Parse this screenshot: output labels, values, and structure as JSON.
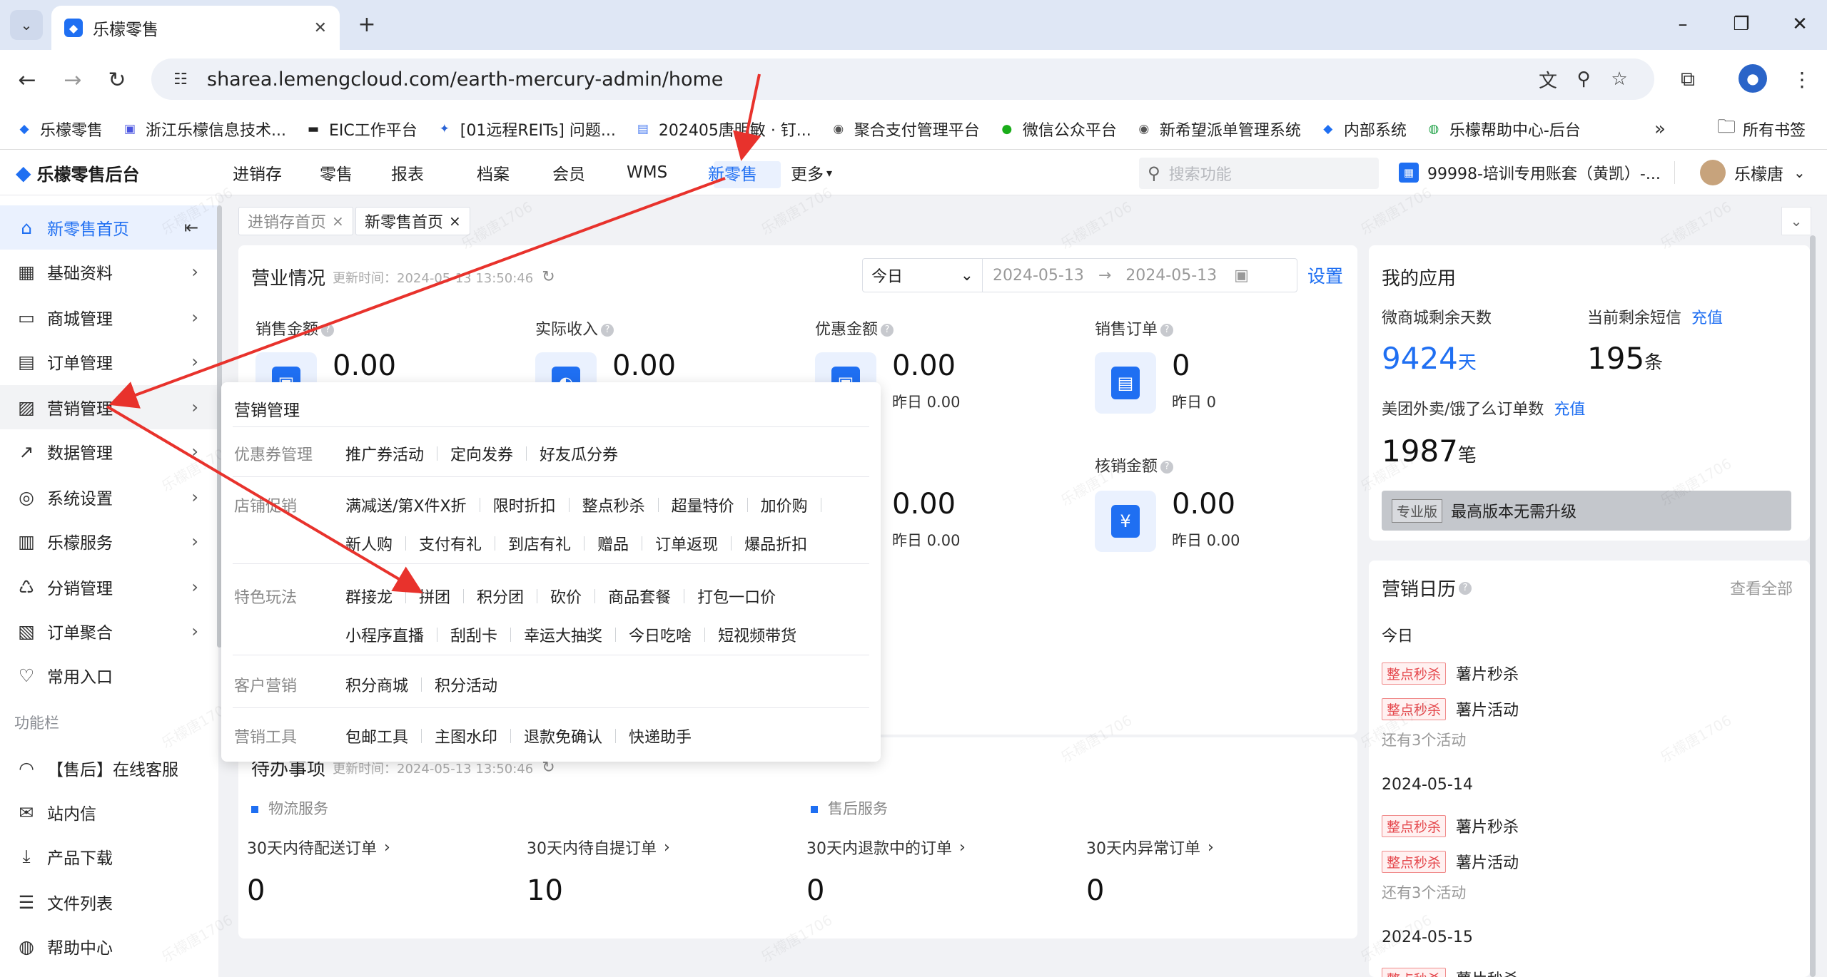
{
  "browser": {
    "tab_title": "乐檬零售",
    "url": "sharea.lemengcloud.com/earth-mercury-admin/home",
    "bookmarks": [
      {
        "label": "乐檬零售",
        "icon": "lemon-icon"
      },
      {
        "label": "浙江乐檬信息技术...",
        "icon": "app-icon"
      },
      {
        "label": "EIC工作平台",
        "icon": "eic-icon"
      },
      {
        "label": "[01远程REITs] 问题...",
        "icon": "jira-icon"
      },
      {
        "label": "202405唐明敏 · 钉...",
        "icon": "doc-icon"
      },
      {
        "label": "聚合支付管理平台",
        "icon": "globe-icon"
      },
      {
        "label": "微信公众平台",
        "icon": "wechat-icon"
      },
      {
        "label": "新希望派单管理系统",
        "icon": "globe-icon"
      },
      {
        "label": "内部系统",
        "icon": "lemon-icon"
      },
      {
        "label": "乐檬帮助中心-后台",
        "icon": "help-icon"
      }
    ],
    "bookmarks_more": "»",
    "all_bookmarks": "所有书签"
  },
  "app": {
    "logo": "乐檬零售后台",
    "nav": [
      "进销存",
      "零售",
      "报表",
      "档案",
      "会员",
      "WMS",
      "新零售",
      "更多"
    ],
    "active_nav": "新零售",
    "search_placeholder": "搜索功能",
    "account": "99998-培训专用账套（黄凯）-...",
    "user": "乐檬唐"
  },
  "sidebar": {
    "items": [
      {
        "label": "新零售首页",
        "icon": "home-icon"
      },
      {
        "label": "基础资料",
        "icon": "grid-icon"
      },
      {
        "label": "商城管理",
        "icon": "store-icon"
      },
      {
        "label": "订单管理",
        "icon": "order-icon"
      },
      {
        "label": "营销管理",
        "icon": "marketing-icon"
      },
      {
        "label": "数据管理",
        "icon": "chart-icon"
      },
      {
        "label": "系统设置",
        "icon": "settings-icon"
      },
      {
        "label": "乐檬服务",
        "icon": "service-icon"
      },
      {
        "label": "分销管理",
        "icon": "distribution-icon"
      },
      {
        "label": "订单聚合",
        "icon": "aggregate-icon"
      },
      {
        "label": "常用入口",
        "icon": "heart-icon"
      }
    ],
    "function_bar_label": "功能栏",
    "function_items": [
      {
        "label": "【售后】在线客服",
        "icon": "headset-icon"
      },
      {
        "label": "站内信",
        "icon": "mail-icon"
      },
      {
        "label": "产品下载",
        "icon": "download-icon"
      },
      {
        "label": "文件列表",
        "icon": "file-list-icon"
      },
      {
        "label": "帮助中心",
        "icon": "help-icon"
      }
    ]
  },
  "page_tabs": [
    {
      "label": "进销存首页",
      "active": false
    },
    {
      "label": "新零售首页",
      "active": true
    }
  ],
  "business": {
    "title": "营业情况",
    "updated": "更新时间：2024-05-13 13:50:46",
    "date_select": "今日",
    "date_from": "2024-05-13",
    "date_to": "2024-05-13",
    "date_sep": "→",
    "settings": "设置",
    "metrics": [
      {
        "label": "销售金额",
        "value": "0.00",
        "sub": ""
      },
      {
        "label": "实际收入",
        "value": "0.00",
        "sub": ""
      },
      {
        "label": "优惠金额",
        "value": "0.00",
        "sub": "昨日 0.00"
      },
      {
        "label": "销售订单",
        "value": "0",
        "sub": "昨日 0"
      },
      {
        "label": "",
        "value": "0.00",
        "sub": "昨日 0.00"
      },
      {
        "label": "核销金额",
        "value": "0.00",
        "sub": "昨日 0.00"
      }
    ]
  },
  "apps": {
    "title": "我的应用",
    "mall_days_label": "微商城剩余天数",
    "mall_days": "9424",
    "mall_days_unit": "天",
    "sms_label": "当前剩余短信",
    "sms_recharge": "充值",
    "sms_count": "195",
    "sms_unit": "条",
    "takeout_label": "美团外卖/饿了么订单数",
    "takeout_recharge": "充值",
    "takeout_count": "1987",
    "takeout_unit": "笔",
    "edition_tag": "专业版",
    "edition_text": "最高版本无需升级"
  },
  "calendar": {
    "title": "营销日历",
    "view_all": "查看全部",
    "groups": [
      {
        "date": "今日",
        "items": [
          {
            "tag": "整点秒杀",
            "name": "薯片秒杀"
          },
          {
            "tag": "整点秒杀",
            "name": "薯片活动"
          }
        ],
        "more": "还有3个活动"
      },
      {
        "date": "2024-05-14",
        "items": [
          {
            "tag": "整点秒杀",
            "name": "薯片秒杀"
          },
          {
            "tag": "整点秒杀",
            "name": "薯片活动"
          }
        ],
        "more": "还有3个活动"
      },
      {
        "date": "2024-05-15",
        "items": [
          {
            "tag": "整点秒杀",
            "name": "薯片秒杀"
          }
        ],
        "more": ""
      }
    ]
  },
  "todo": {
    "title": "待办事项",
    "updated": "更新时间：2024-05-13 13:50:46",
    "sections": [
      "物流服务",
      "售后服务"
    ],
    "items": [
      {
        "label": "30天内待配送订单",
        "value": "0"
      },
      {
        "label": "30天内待自提订单",
        "value": "10"
      },
      {
        "label": "30天内退款中的订单",
        "value": "0"
      },
      {
        "label": "30天内异常订单",
        "value": "0"
      }
    ]
  },
  "popup": {
    "title": "营销管理",
    "groups": [
      {
        "category": "优惠券管理",
        "rows": [
          [
            "推广券活动",
            "定向发券",
            "好友瓜分券"
          ]
        ]
      },
      {
        "category": "店铺促销",
        "rows": [
          [
            "满减送/第X件X折",
            "限时折扣",
            "整点秒杀",
            "超量特价",
            "加价购"
          ],
          [
            "新人购",
            "支付有礼",
            "到店有礼",
            "赠品",
            "订单返现",
            "爆品折扣"
          ]
        ]
      },
      {
        "category": "特色玩法",
        "rows": [
          [
            "群接龙",
            "拼团",
            "积分团",
            "砍价",
            "商品套餐",
            "打包一口价"
          ],
          [
            "小程序直播",
            "刮刮卡",
            "幸运大抽奖",
            "今日吃啥",
            "短视频带货"
          ]
        ]
      },
      {
        "category": "客户营销",
        "rows": [
          [
            "积分商城",
            "积分活动"
          ]
        ]
      },
      {
        "category": "营销工具",
        "rows": [
          [
            "包邮工具",
            "主图水印",
            "退款免确认",
            "快递助手"
          ]
        ]
      }
    ]
  },
  "watermark": "乐檬唐1706",
  "colors": {
    "accent": "#1f6ff2",
    "annotation": "#e8322c",
    "tag_red": "#e5484d"
  }
}
